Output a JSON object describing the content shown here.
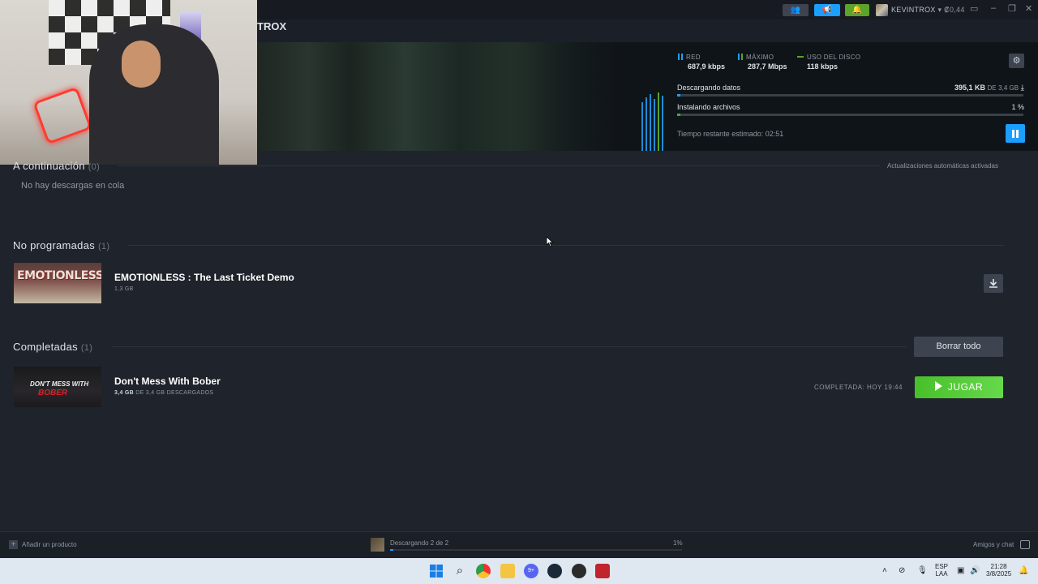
{
  "topbar": {
    "username": "KEVINTROX",
    "balance": "₡0,44",
    "window_controls": [
      "minimize-icon",
      "maximize-icon",
      "close-icon"
    ]
  },
  "header": {
    "title": "TROX"
  },
  "stats": {
    "network": {
      "label": "RED",
      "value": "687,9 kbps"
    },
    "peak": {
      "label": "MÁXIMO",
      "value": "287,7 Mbps"
    },
    "disk": {
      "label": "USO DEL DISCO",
      "value": "118 kbps"
    }
  },
  "current_download": {
    "downloading_label": "Descargando datos",
    "downloaded": "395,1 KB",
    "of": "DE",
    "total": "3,4 GB",
    "download_progress": 0.01,
    "installing_label": "Instalando archivos",
    "install_percent": "1 %",
    "install_progress": 0.01,
    "eta": "Tiempo restante estimado: 02:51"
  },
  "queue": {
    "title": "A continuación",
    "count": "(0)",
    "empty_text": "No hay descargas en cola",
    "auto_updates": "Actualizaciones automáticas activadas"
  },
  "unscheduled": {
    "title": "No programadas",
    "count": "(1)",
    "items": [
      {
        "name": "EMOTIONLESS : The Last Ticket Demo",
        "size": "1,3 GB",
        "thumb_text": "EMOTIONLESS"
      }
    ]
  },
  "completed": {
    "title": "Completadas",
    "count": "(1)",
    "clear_all": "Borrar todo",
    "items": [
      {
        "name": "Don't Mess With Bober",
        "size_done": "3,4 GB",
        "size_rest": "DE 3,4 GB DESCARGADOS",
        "status": "COMPLETADA: HOY 19:44",
        "play_label": "JUGAR",
        "thumb_text_1": "DON'T MESS WITH",
        "thumb_text_2": "BOBER"
      }
    ]
  },
  "footer": {
    "add_product": "Añadir un producto",
    "status": "Descargando 2 de 2",
    "percent": "1%",
    "progress": 0.01,
    "friends_chat": "Amigos y chat"
  },
  "taskbar": {
    "lang_1": "ESP",
    "lang_2": "LAA",
    "time": "21:28",
    "date": "3/8/2025",
    "discord_badge": "9+"
  },
  "colors": {
    "accent_blue": "#1a9fff",
    "play_green": "#5cd63b",
    "background": "#1f232b"
  }
}
